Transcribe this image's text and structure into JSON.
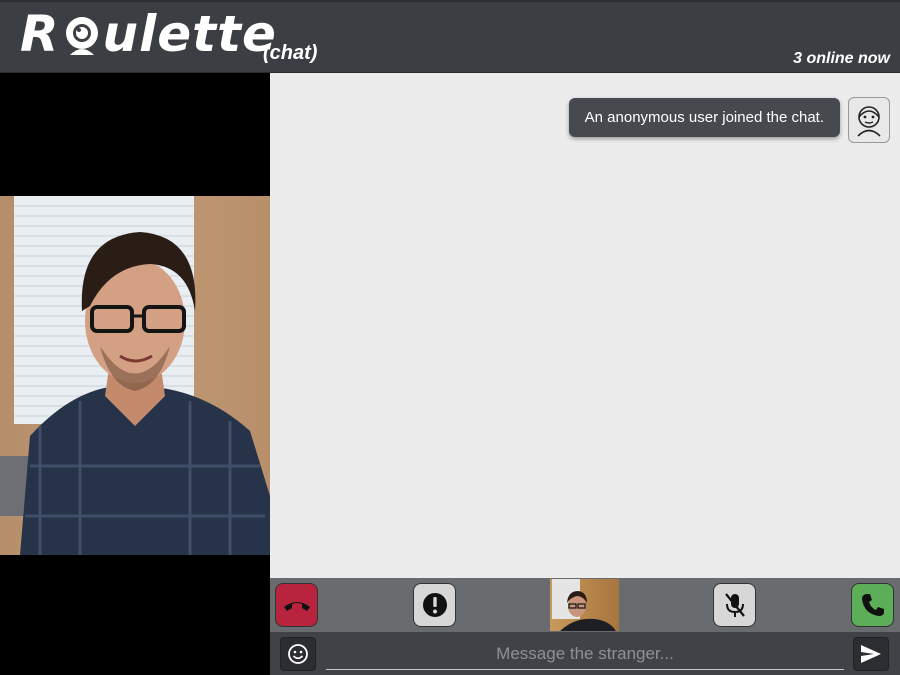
{
  "header": {
    "logo_prefix": "R",
    "logo_suffix": "ulette",
    "logo_sub": "(chat)",
    "online_text": "3 online now"
  },
  "chat": {
    "messages": [
      {
        "text": "An anonymous user joined the chat.",
        "sender_icon": "anonymous-user-icon"
      }
    ]
  },
  "controls": {
    "hangup_icon": "phone-hangup-icon",
    "report_icon": "exclamation-icon",
    "mute_icon": "mic-off-icon",
    "call_icon": "phone-icon"
  },
  "input": {
    "placeholder": "Message the stranger...",
    "value": "",
    "emoji_icon": "smiley-icon",
    "send_icon": "send-icon"
  },
  "colors": {
    "header_bg": "#3b3e42",
    "chat_bg": "#ececec",
    "bubble_bg": "#46494d",
    "hangup": "#b8233e",
    "call": "#5cae58"
  }
}
